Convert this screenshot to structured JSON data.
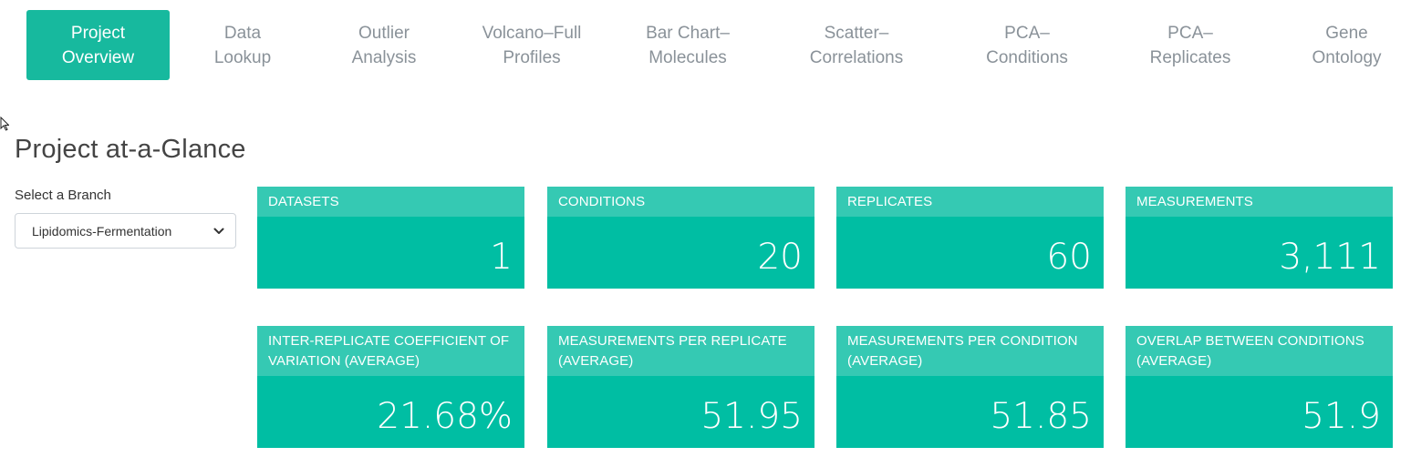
{
  "nav": {
    "items": [
      {
        "line1": "Project",
        "line2": "Overview"
      },
      {
        "line1": "Data",
        "line2": "Lookup"
      },
      {
        "line1": "Outlier",
        "line2": "Analysis"
      },
      {
        "line1": "Volcano–Full",
        "line2": "Profiles"
      },
      {
        "line1": "Bar Chart–",
        "line2": "Molecules"
      },
      {
        "line1": "Scatter–",
        "line2": "Correlations"
      },
      {
        "line1": "PCA–",
        "line2": "Conditions"
      },
      {
        "line1": "PCA–",
        "line2": "Replicates"
      },
      {
        "line1": "Gene",
        "line2": "Ontology"
      }
    ],
    "active_index": 0
  },
  "page": {
    "title": "Project at-a-Glance",
    "branch_label": "Select a Branch",
    "branch_value": "Lipidomics-Fermentation"
  },
  "cards": [
    {
      "label": "DATASETS",
      "value": "1"
    },
    {
      "label": "CONDITIONS",
      "value": "20"
    },
    {
      "label": "REPLICATES",
      "value": "60"
    },
    {
      "label": "MEASUREMENTS",
      "value": "3,111"
    },
    {
      "label": "INTER-REPLICATE COEFFICIENT OF VARIATION (AVERAGE)",
      "value": "21.68%"
    },
    {
      "label": "MEASUREMENTS PER REPLICATE (AVERAGE)",
      "value": "51.95"
    },
    {
      "label": "MEASUREMENTS PER CONDITION (AVERAGE)",
      "value": "51.85"
    },
    {
      "label": "OVERLAP BETWEEN CONDITIONS (AVERAGE)",
      "value": "51.9"
    }
  ],
  "colors": {
    "accent": "#17b99e",
    "card_body": "#00bea3",
    "card_header": "#35c9b3",
    "nav_inactive": "#8a9299"
  }
}
